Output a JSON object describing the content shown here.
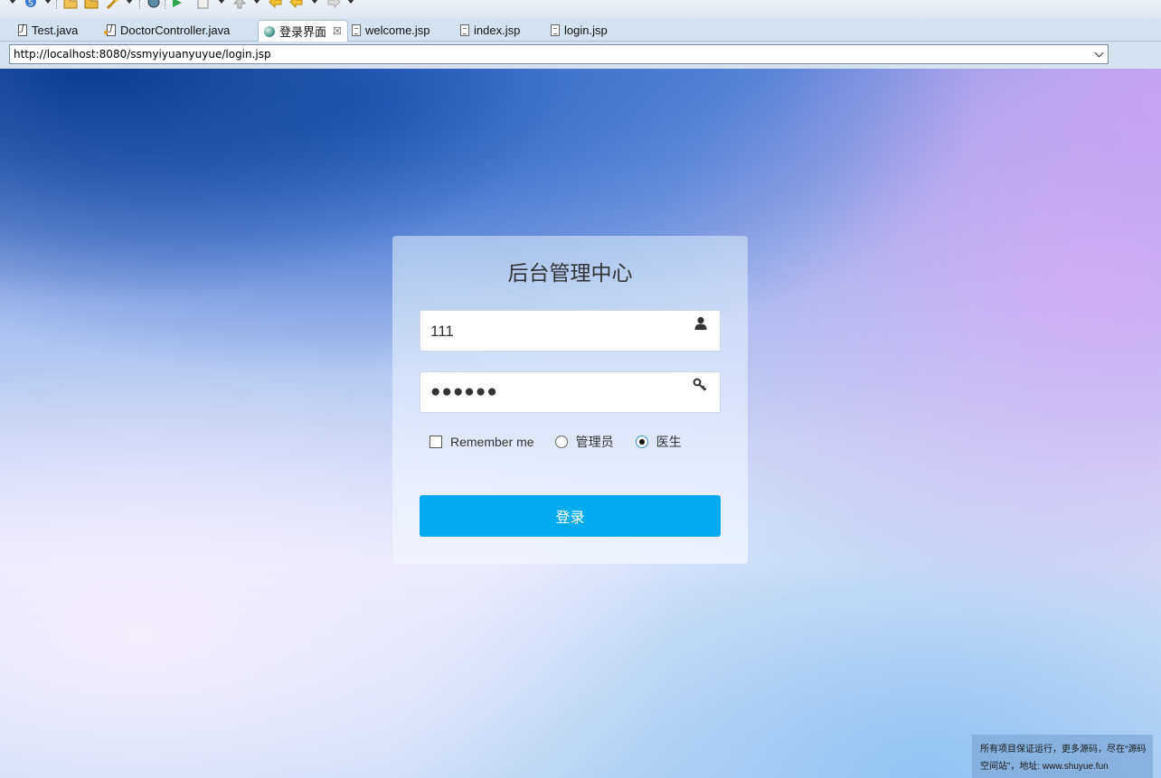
{
  "toolbar": {
    "icons": [
      "run-icon",
      "folder-open-icon",
      "folder-icon",
      "wand-icon",
      "globe-icon",
      "debug-run-icon",
      "page-icon",
      "up-arrow-icon",
      "back-arrow-icon",
      "forward-arrow-icon"
    ]
  },
  "tabs": [
    {
      "label": "Test.java",
      "icon": "java-file-icon"
    },
    {
      "label": "DoctorController.java",
      "icon": "java-file-icon"
    },
    {
      "label": "登录界面",
      "icon": "globe-icon",
      "active": true,
      "close": "☒"
    },
    {
      "label": "welcome.jsp",
      "icon": "jsp-file-icon"
    },
    {
      "label": "index.jsp",
      "icon": "jsp-file-icon"
    },
    {
      "label": "login.jsp",
      "icon": "jsp-file-icon"
    }
  ],
  "address_bar": {
    "url": "http://localhost:8080/ssmyiyuanyuyue/login.jsp"
  },
  "login": {
    "title": "后台管理中心",
    "username_value": "111",
    "password_masked": "●●●●●●",
    "remember_label": "Remember me",
    "remember_checked": false,
    "role_options": [
      {
        "label": "管理员",
        "selected": false
      },
      {
        "label": "医生",
        "selected": true
      }
    ],
    "submit_label": "登录",
    "submit_color": "#02aaf0"
  },
  "watermark": {
    "line1": "所有项目保证运行，更多源码，尽在“源码",
    "line2": "空间站”，地址: www.shuyue.fun"
  }
}
